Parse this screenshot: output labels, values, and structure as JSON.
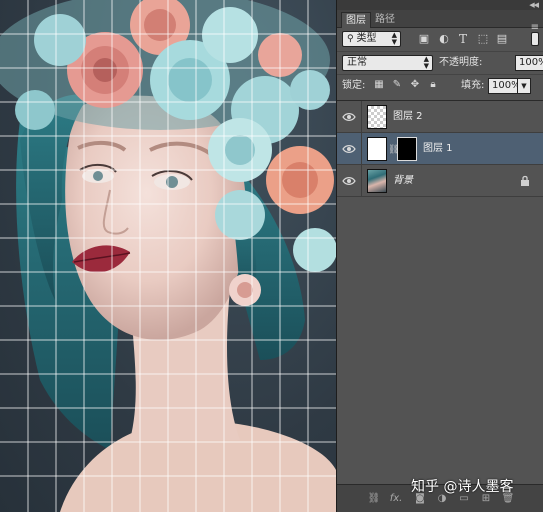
{
  "panel": {
    "tabs": [
      {
        "label": "图层",
        "active": true
      },
      {
        "label": "路径",
        "active": false
      }
    ],
    "filter": {
      "kind_label": "类型",
      "icons": [
        "image-filter-icon",
        "adjustment-filter-icon",
        "type-filter-icon",
        "shape-filter-icon",
        "smart-object-filter-icon"
      ]
    },
    "blend_mode": "正常",
    "opacity_label": "不透明度:",
    "opacity_value": "100%",
    "lock_label": "锁定:",
    "fill_label": "填充:",
    "fill_value": "100%",
    "layers": [
      {
        "name": "图层 2",
        "visible": true,
        "selected": false,
        "thumb": "transparent"
      },
      {
        "name": "图层 1",
        "visible": true,
        "selected": true,
        "thumb": "white",
        "mask": "black",
        "linked": true
      },
      {
        "name": "背景",
        "visible": true,
        "selected": false,
        "thumb": "photo",
        "locked": true
      }
    ],
    "bottom_icons": [
      "link-layers-icon",
      "fx-icon",
      "add-mask-icon",
      "adjustment-layer-icon",
      "group-icon",
      "new-layer-icon",
      "trash-icon"
    ],
    "fx_label": "fx."
  },
  "watermark": "知乎 @诗人墨客",
  "colors": {
    "panel_bg": "#535353",
    "selected_layer": "#4e6073",
    "hair": "#2f7f8a",
    "flower_pink": "#e59a92",
    "flower_blue": "#9fd1d6",
    "lips": "#9b2a3c"
  }
}
